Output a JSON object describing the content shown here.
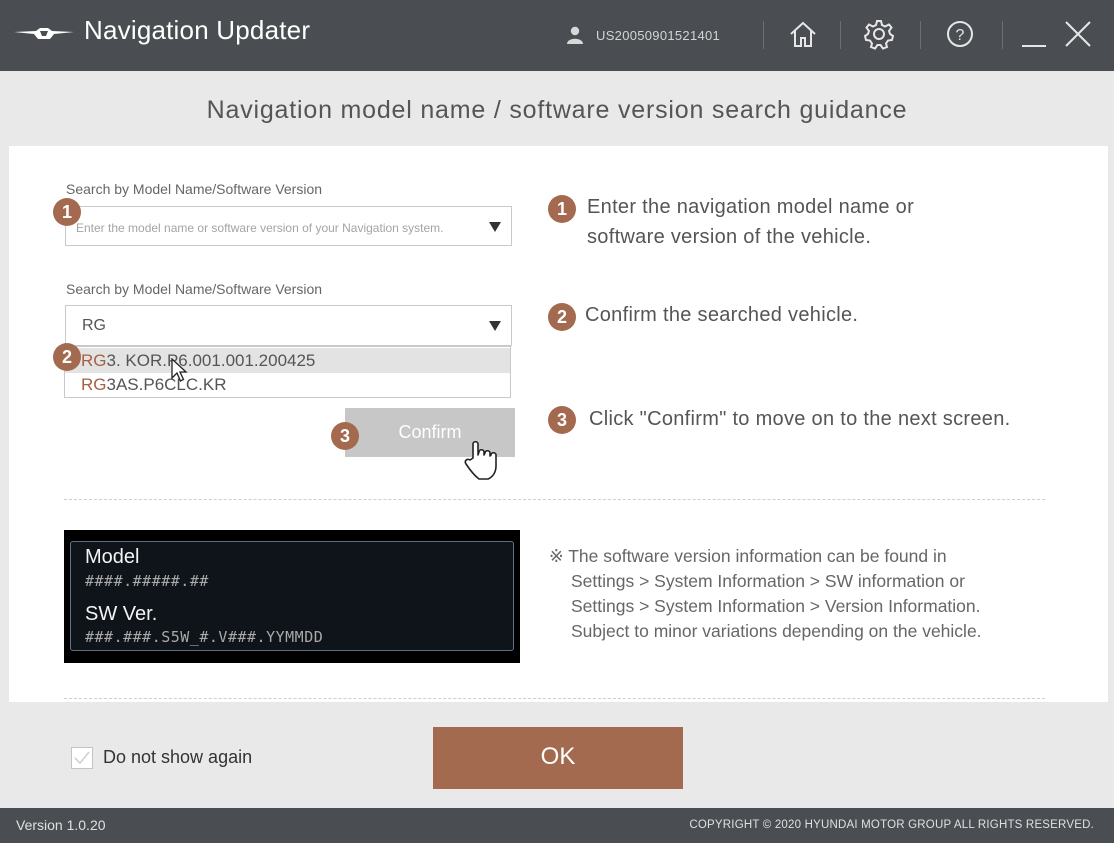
{
  "window": {
    "title": "Navigation Updater",
    "user_id": "US20050901521401"
  },
  "heading": "Navigation model name / software version search guidance",
  "search1": {
    "label": "Search by Model Name/Software Version",
    "placeholder": "Enter the model name or software version of your Navigation system.",
    "badge": "1"
  },
  "search2": {
    "label": "Search by Model Name/Software Version",
    "value": "RG",
    "badge": "2",
    "options": [
      {
        "match": "RG",
        "rest": "3. KOR.P6.001.001.200425"
      },
      {
        "match": "RG",
        "rest": "3AS.P6CLC.KR"
      }
    ]
  },
  "confirm": {
    "label": "Confirm",
    "badge": "3"
  },
  "steps": [
    {
      "num": "1",
      "line1": "Enter the navigation model name or",
      "line2": "software version of the vehicle."
    },
    {
      "num": "2",
      "line1": "Confirm the searched vehicle."
    },
    {
      "num": "3",
      "line1": "Click \"Confirm\" to move on to the next screen."
    }
  ],
  "screen": {
    "model_title": "Model",
    "model_value": "####.#####.##",
    "sw_title": "SW Ver.",
    "sw_value": "###.###.S5W_#.V###.YYMMDD"
  },
  "note": {
    "line1": "※ The software version information can be found in",
    "line2": "Settings > System Information > SW information or",
    "line3": "Settings > System Information > Version Information.",
    "line4": "Subject to minor variations depending on the vehicle."
  },
  "footer": {
    "dont_show": "Do not show again",
    "ok": "OK",
    "version": "Version 1.0.20",
    "copyright": "COPYRIGHT © 2020 HYUNDAI MOTOR GROUP ALL RIGHTS RESERVED."
  },
  "colors": {
    "accent": "#a46a4f",
    "titlebar": "#4a4d51",
    "background": "#e9e9e9"
  },
  "icons": [
    "genesis-logo-icon",
    "user-icon",
    "home-icon",
    "gear-icon",
    "help-icon",
    "minimize-icon",
    "close-icon",
    "pointer-cursor-icon",
    "hand-cursor-icon",
    "checkmark-icon"
  ]
}
